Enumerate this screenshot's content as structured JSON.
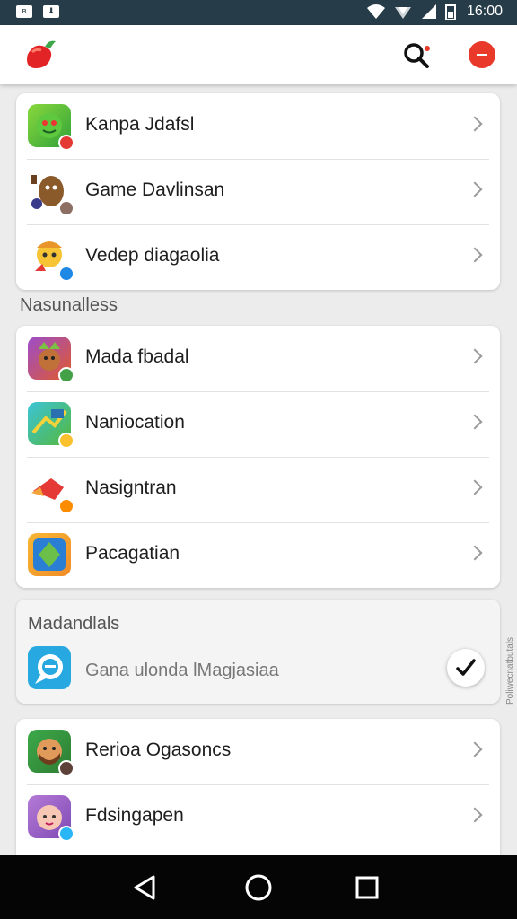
{
  "status_bar": {
    "left_icons": [
      "notification-icon",
      "download-icon"
    ],
    "time": "16:00",
    "colors": {
      "background": "#263c48"
    }
  },
  "app_bar": {
    "logo": "chili-pepper-logo",
    "search_icon": "search-icon",
    "add_icon": "add-icon",
    "colors": {
      "accent": "#e8392a"
    }
  },
  "group1": {
    "items": [
      {
        "label": "Kanpa Jdafsl",
        "icon": "green-face-app-icon"
      },
      {
        "label": "Game Davlinsan",
        "icon": "brown-character-app-icon"
      },
      {
        "label": "Vedep diagaolia",
        "icon": "yellow-character-app-icon"
      }
    ]
  },
  "section_title": "Nasunalless",
  "group2": {
    "items": [
      {
        "label": "Mada fbadal",
        "icon": "purple-character-app-icon"
      },
      {
        "label": "Naniocation",
        "icon": "green-game-app-icon"
      },
      {
        "label": "Nasigntran",
        "icon": "red-shoe-app-icon"
      },
      {
        "label": "Pacagatian",
        "icon": "orange-leaf-app-icon"
      }
    ]
  },
  "selected_card": {
    "title": "Madandlals",
    "label": "Gana ulonda lMagjasiaa",
    "icon": "blue-chat-app-icon",
    "check_icon": "checkmark-icon"
  },
  "group3": {
    "items": [
      {
        "label": "Rerioa Ogasoncs",
        "icon": "bearded-character-app-icon"
      },
      {
        "label": "Fdsingapen",
        "icon": "pink-baby-app-icon"
      }
    ]
  },
  "side_text": "Poliwecnatbutals",
  "nav_bar": {
    "back_icon": "back-triangle-icon",
    "home_icon": "home-circle-icon",
    "recents_icon": "recents-square-icon"
  }
}
